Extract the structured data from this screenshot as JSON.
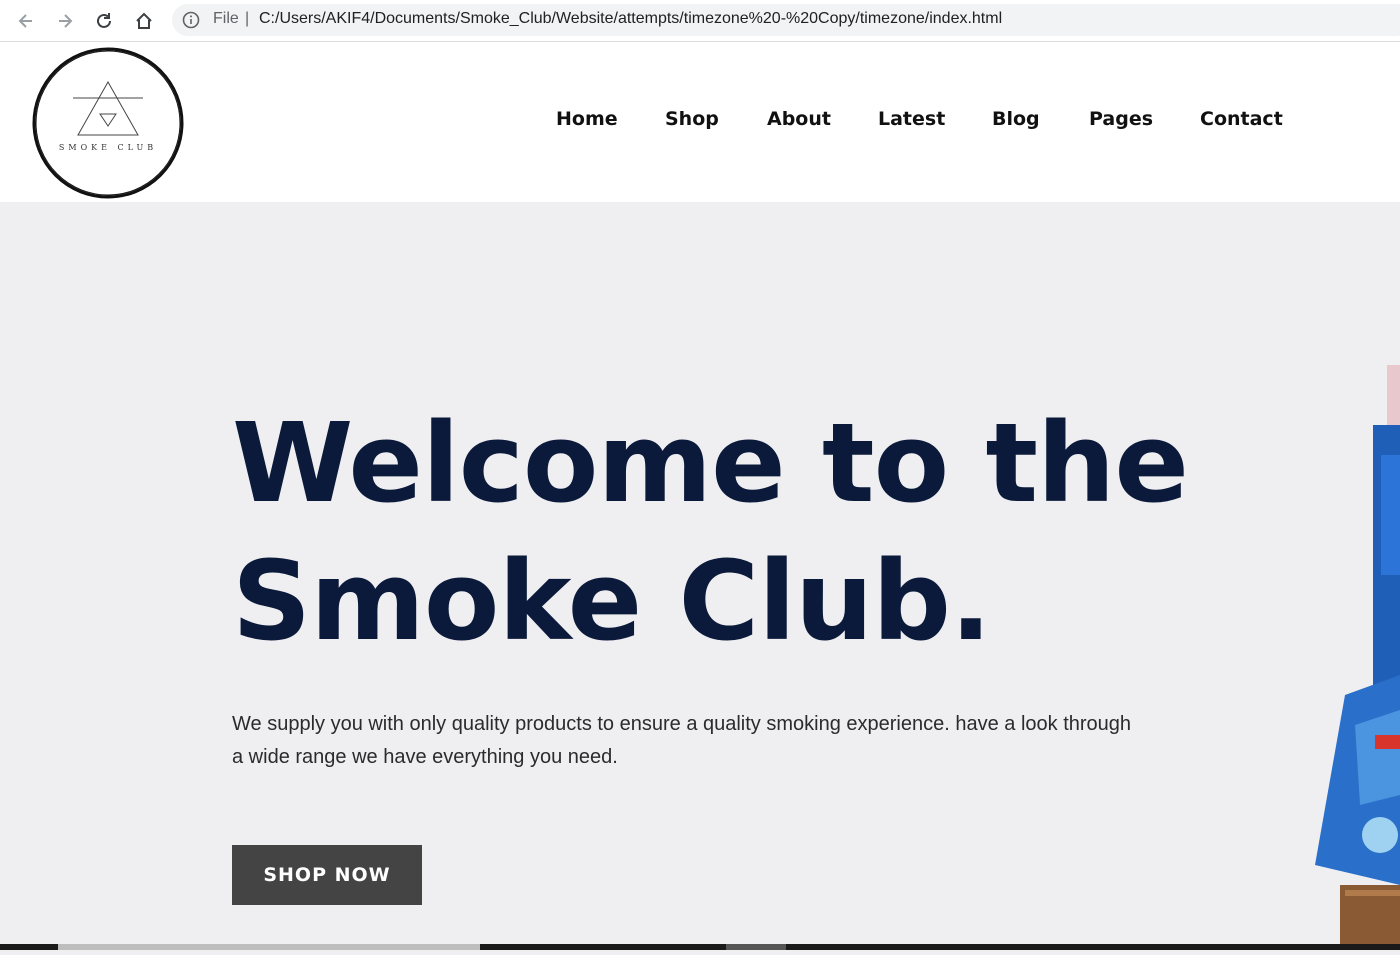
{
  "browser": {
    "file_label": "File",
    "separator": "|",
    "url": "C:/Users/AKIF4/Documents/Smoke_Club/Website/attempts/timezone%20-%20Copy/timezone/index.html"
  },
  "logo": {
    "text": "SMOKE CLUB"
  },
  "nav": {
    "items": [
      "Home",
      "Shop",
      "About",
      "Latest",
      "Blog",
      "Pages",
      "Contact"
    ]
  },
  "hero": {
    "title_line1": "Welcome to the",
    "title_line2": "Smoke Club.",
    "description": "We supply you with only quality products to ensure a quality smoking experience. have a look through a wide range we have everything you need.",
    "button_label": "SHOP NOW"
  },
  "colors": {
    "hero_bg": "#efeff2",
    "title": "#0b1a3a",
    "button_bg": "#444444"
  }
}
